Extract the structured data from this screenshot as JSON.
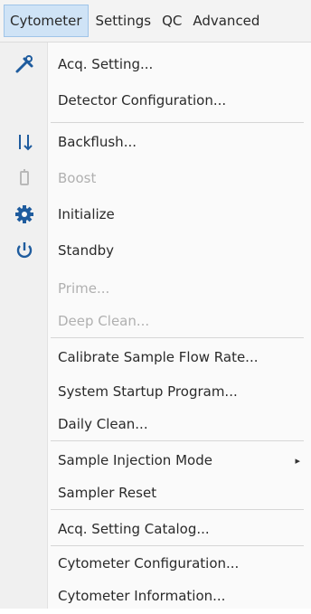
{
  "menubar": {
    "items": [
      {
        "label": "Cytometer",
        "active": true
      },
      {
        "label": "Settings"
      },
      {
        "label": "QC"
      },
      {
        "label": "Advanced"
      }
    ]
  },
  "menu": {
    "items": [
      {
        "label": "Acq. Setting...",
        "icon": "wrench-tools-icon",
        "enabled": true
      },
      {
        "label": "Detector Configuration...",
        "enabled": true
      },
      {
        "label": "Backflush...",
        "icon": "backflush-icon",
        "enabled": true
      },
      {
        "label": "Boost",
        "icon": "boost-icon",
        "enabled": false
      },
      {
        "label": "Initialize",
        "icon": "gear-icon",
        "enabled": true
      },
      {
        "label": "Standby",
        "icon": "power-icon",
        "enabled": true
      },
      {
        "label": "Prime...",
        "enabled": false
      },
      {
        "label": "Deep Clean...",
        "enabled": false
      },
      {
        "label": "Calibrate Sample Flow Rate...",
        "enabled": true
      },
      {
        "label": "System Startup Program...",
        "enabled": true
      },
      {
        "label": "Daily Clean...",
        "enabled": true
      },
      {
        "label": "Sample Injection Mode",
        "enabled": true,
        "submenu": true,
        "submenu_arrow": "▸"
      },
      {
        "label": "Sampler Reset",
        "enabled": true
      },
      {
        "label": "Acq. Setting Catalog...",
        "enabled": true
      },
      {
        "label": "Cytometer Configuration...",
        "enabled": true
      },
      {
        "label": "Cytometer Information...",
        "enabled": true
      }
    ]
  },
  "colors": {
    "active_menu_bg": "#cfe3f6",
    "disabled_text": "#b0b0b0",
    "icon_blue": "#1f5c9e"
  }
}
